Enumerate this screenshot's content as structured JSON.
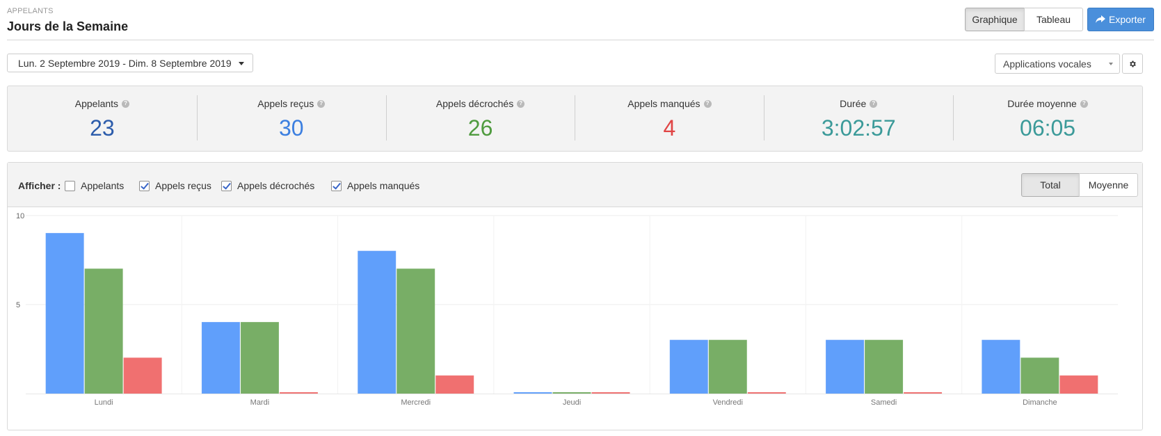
{
  "header": {
    "supertitle": "APPELANTS",
    "title": "Jours de la Semaine",
    "view_tabs": [
      {
        "label": "Graphique",
        "active": true
      },
      {
        "label": "Tableau",
        "active": false
      }
    ],
    "export_label": "Exporter"
  },
  "filters": {
    "date_range": "Lun. 2 Septembre 2019 - Dim. 8 Septembre 2019",
    "application_select": "Applications vocales"
  },
  "stats": [
    {
      "label": "Appelants",
      "value": "23",
      "color": "#2c5cab"
    },
    {
      "label": "Appels reçus",
      "value": "30",
      "color": "#3c7fe0"
    },
    {
      "label": "Appels décrochés",
      "value": "26",
      "color": "#4f9b3f"
    },
    {
      "label": "Appels manqués",
      "value": "4",
      "color": "#e04545"
    },
    {
      "label": "Durée",
      "value": "3:02:57",
      "color": "#3b9a99"
    },
    {
      "label": "Durée moyenne",
      "value": "06:05",
      "color": "#3b9a99"
    }
  ],
  "chart_toolbar": {
    "show_label": "Afficher :",
    "checkboxes": [
      {
        "label": "Appelants",
        "checked": false
      },
      {
        "label": "Appels reçus",
        "checked": true
      },
      {
        "label": "Appels décrochés",
        "checked": true
      },
      {
        "label": "Appels manqués",
        "checked": true
      }
    ],
    "mode_tabs": [
      {
        "label": "Total",
        "active": true
      },
      {
        "label": "Moyenne",
        "active": false
      }
    ]
  },
  "chart_data": {
    "type": "bar",
    "categories": [
      "Lundi",
      "Mardi",
      "Mercredi",
      "Jeudi",
      "Vendredi",
      "Samedi",
      "Dimanche"
    ],
    "series": [
      {
        "values": [
          9,
          4,
          8,
          0,
          3,
          3,
          3
        ],
        "color": "#609ffb"
      },
      {
        "values": [
          7,
          4,
          7,
          0,
          3,
          3,
          2
        ],
        "color": "#78ae66"
      },
      {
        "values": [
          2,
          0,
          1,
          0,
          0,
          0,
          1
        ],
        "color": "#f07070"
      }
    ],
    "ylim": [
      0,
      10
    ],
    "yticks": [
      "10",
      "5"
    ],
    "grid": true,
    "legend": "none"
  }
}
